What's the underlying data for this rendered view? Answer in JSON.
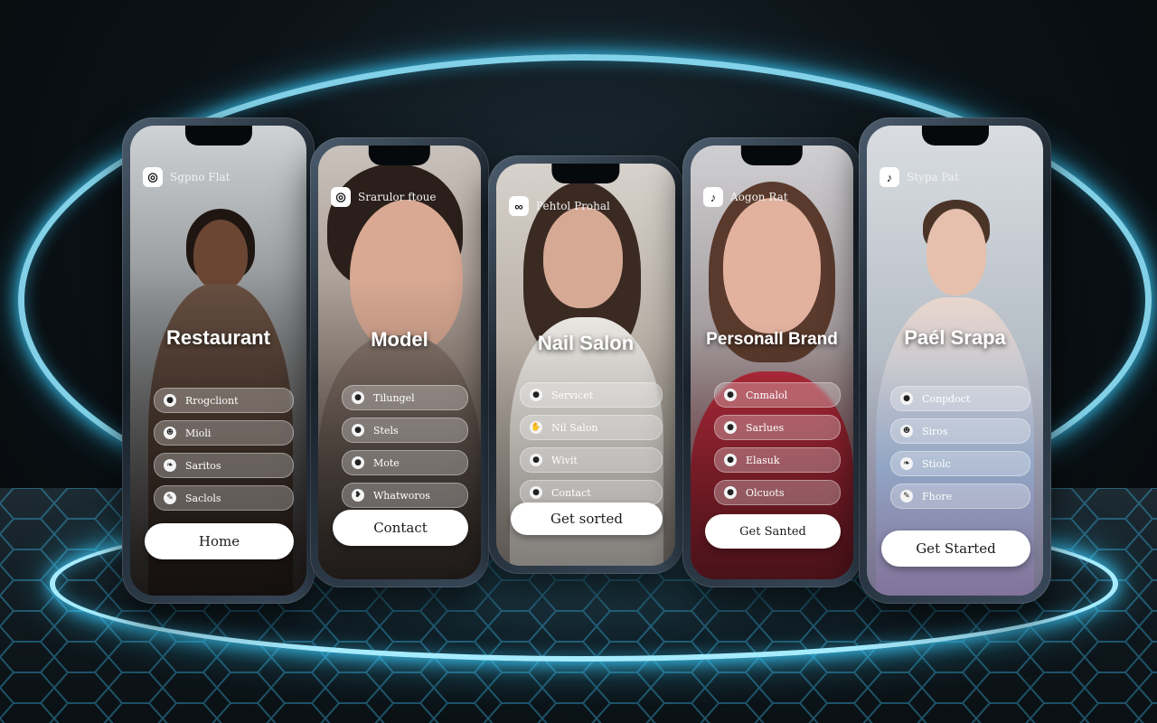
{
  "colors": {
    "neon": "#8fe6ff",
    "glass": "rgba(255,255,255,0.28)"
  },
  "phones": [
    {
      "brand_icon": "instagram-icon",
      "brand": "Sgpno Flat",
      "title": "Restaurant",
      "items": [
        {
          "icon": "circle-icon",
          "label": "Rrogcliont"
        },
        {
          "icon": "people-icon",
          "label": "Mioli"
        },
        {
          "icon": "leaf-icon",
          "label": "Saritos"
        },
        {
          "icon": "feather-icon",
          "label": "Saclols"
        }
      ],
      "cta": "Home"
    },
    {
      "brand_icon": "instagram-icon",
      "brand": "Srarulor ftoue",
      "title": "Model",
      "items": [
        {
          "icon": "circle-icon",
          "label": "Tilungel"
        },
        {
          "icon": "circle-icon",
          "label": "Stels"
        },
        {
          "icon": "circle-icon",
          "label": "Mote"
        },
        {
          "icon": "drop-icon",
          "label": "Whatworos"
        }
      ],
      "cta": "Contact"
    },
    {
      "brand_icon": "link-icon",
      "brand": "Pehtol Prohal",
      "title": "Nail Salon",
      "items": [
        {
          "icon": "circle-icon",
          "label": "Servicet"
        },
        {
          "icon": "hand-icon",
          "label": "Nil Salon"
        },
        {
          "icon": "circle-icon",
          "label": "Wivit"
        },
        {
          "icon": "circle-icon",
          "label": "Contact"
        }
      ],
      "cta": "Get sorted"
    },
    {
      "brand_icon": "tiktok-icon",
      "brand": "Aogon Rat",
      "title": "Personall Brand",
      "items": [
        {
          "icon": "circle-icon",
          "label": "Cnmalol"
        },
        {
          "icon": "circle-icon",
          "label": "Sarlues"
        },
        {
          "icon": "circle-icon",
          "label": "Elasuk"
        },
        {
          "icon": "circle-icon",
          "label": "Olcuots"
        }
      ],
      "cta": "Get Santed"
    },
    {
      "brand_icon": "tiktok-icon",
      "brand": "Stypa Pat",
      "title": "Paél Srapa",
      "items": [
        {
          "icon": "circle-icon",
          "label": "Conpdoct"
        },
        {
          "icon": "people-icon",
          "label": "Siros"
        },
        {
          "icon": "leaf-icon",
          "label": "Stiolc"
        },
        {
          "icon": "feather-icon",
          "label": "Fhore"
        }
      ],
      "cta": "Get Started"
    }
  ]
}
